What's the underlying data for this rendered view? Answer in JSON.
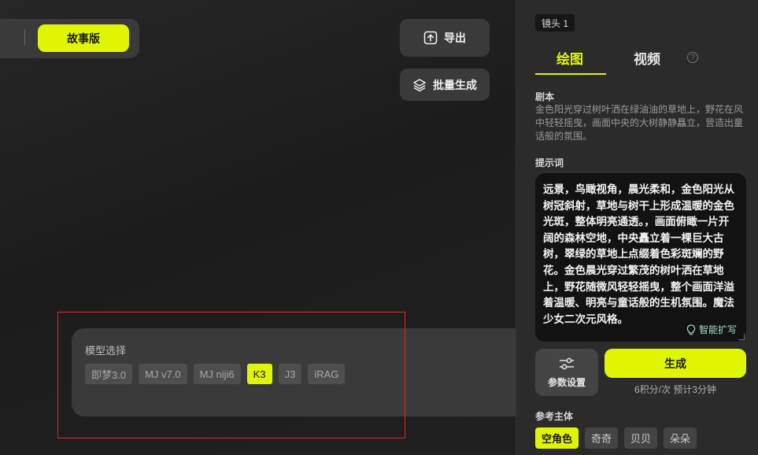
{
  "canvas": {
    "mode_toggle": {
      "story_label": "故事版"
    },
    "export_label": "导出",
    "batch_label": "批量生成",
    "model_panel": {
      "title": "模型选择",
      "models": [
        "即梦3.0",
        "MJ v7.0",
        "MJ niji6",
        "K3",
        "J3",
        "iRAG"
      ],
      "selected": "K3"
    }
  },
  "sidebar": {
    "shot_badge": "镜头 1",
    "tabs": {
      "draw": "绘图",
      "video": "视频",
      "active": "绘图"
    },
    "script_label": "剧本",
    "script_text": "金色阳光穿过树叶洒在绿油油的草地上，野花在风中轻轻摇曳，画面中央的大树静静矗立，营造出童话般的氛围。",
    "prompt_label": "提示词",
    "prompt_text": "远景，鸟瞰视角，晨光柔和，金色阳光从树冠斜射，草地与树干上形成温暖的金色光斑，整体明亮通透。，画面俯瞰一片开阔的森林空地，中央矗立着一棵巨大古树，翠绿的草地上点缀着色彩斑斓的野花。金色晨光穿过繁茂的树叶洒在草地上，野花随微风轻轻摇曳，整个画面洋溢着温暖、明亮与童话般的生机氛围。魔法少女二次元风格。",
    "expand_label": "智能扩写",
    "param_label": "参数设置",
    "generate_label": "生成",
    "cost_text": "6积分/次 预计3分钟",
    "ref_label": "参考主体",
    "ref_subjects": [
      "空角色",
      "奇奇",
      "贝贝",
      "朵朵"
    ],
    "ref_selected": "空角色"
  },
  "colors": {
    "accent": "#e0f500",
    "highlight_box": "#e02a1c"
  }
}
